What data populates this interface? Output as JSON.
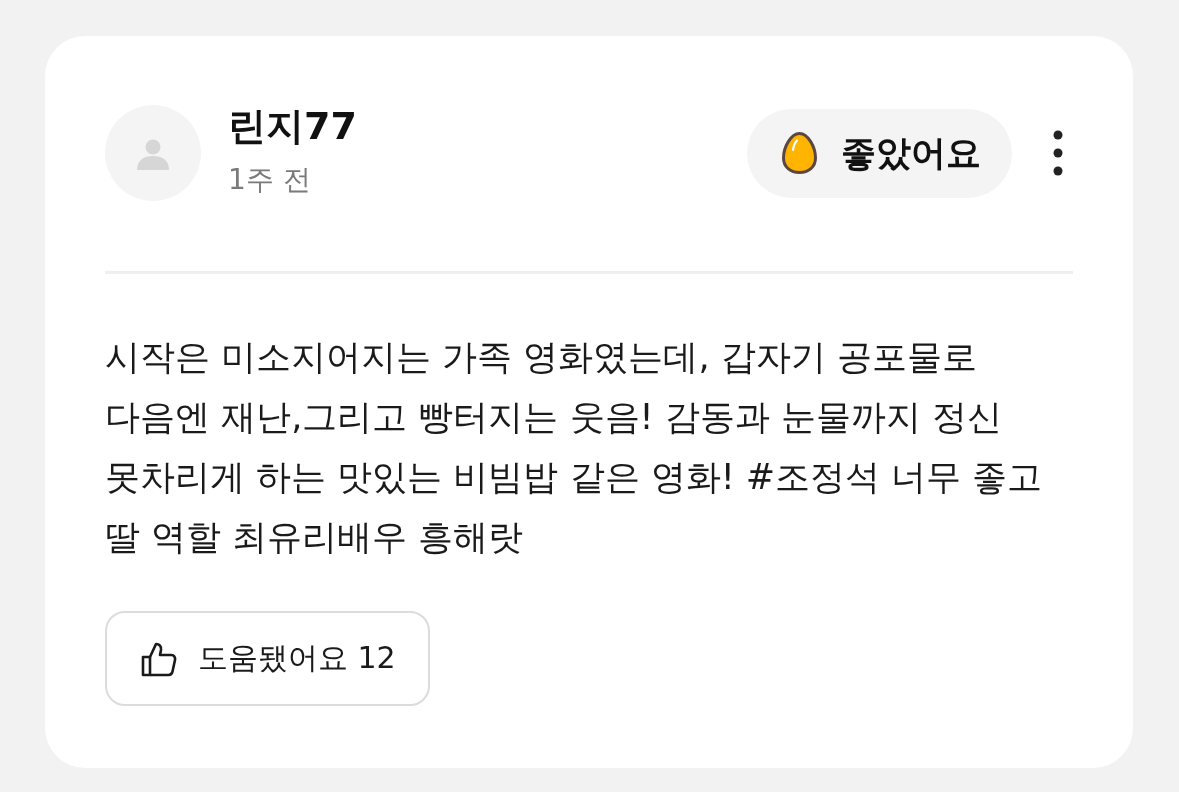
{
  "review": {
    "author": {
      "name": "린지77",
      "time": "1주 전"
    },
    "reaction": {
      "label": "좋았어요"
    },
    "body": "시작은 미소지어지는 가족 영화였는데, 갑자기 공포물로 다음엔 재난,그리고 빵터지는 웃음! 감동과 눈물까지 정신 못차리게 하는 맛있는 비빔밥 같은 영화! #조정석 너무 좋고 딸 역할 최유리배우 흥해랏",
    "helpful": {
      "label": "도움됐어요 12"
    }
  }
}
